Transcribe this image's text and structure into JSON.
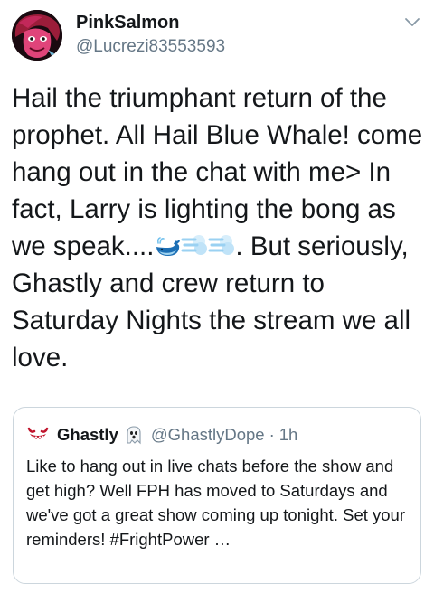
{
  "tweet": {
    "display_name": "PinkSalmon",
    "handle": "@Lucrezi83553593",
    "text_before_emoji": "Hail the triumphant return of the prophet. All Hail Blue Whale! come hang out in the chat with me> In fact, Larry is lighting the bong as we speak....",
    "emojis": [
      "spouting-whale-icon",
      "dash-icon",
      "dash-icon"
    ],
    "text_after_emoji": ". But seriously, Ghastly and crew return to Saturday Nights the stream we all love.",
    "menu_icon": "chevron-down-icon"
  },
  "quote": {
    "name": "Ghastly",
    "handle": "@GhastlyDope",
    "separator": "·",
    "time": "1h",
    "text": "Like to hang out in live chats before the show and get high? Well FPH has moved to Saturdays and we've got a great show coming up tonight. Set your reminders! #FrightPower …"
  },
  "colors": {
    "text": "#14171a",
    "secondary": "#657786",
    "border": "#ccd6dd"
  }
}
